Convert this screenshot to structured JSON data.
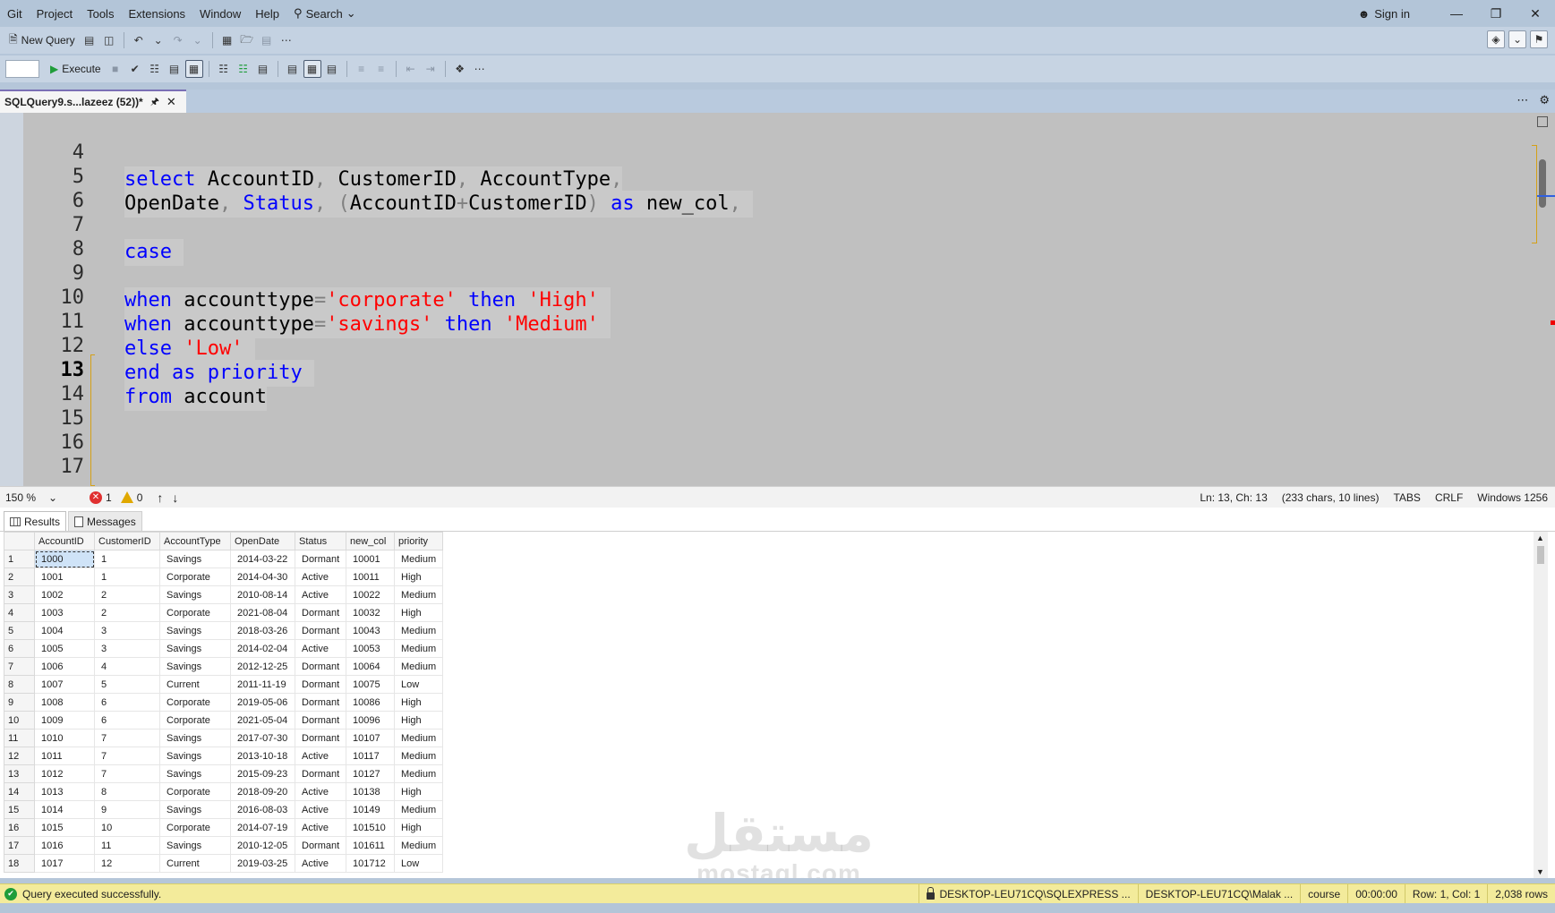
{
  "menu": {
    "items": [
      "Git",
      "Project",
      "Tools",
      "Extensions",
      "Window",
      "Help"
    ],
    "search_label": "Search",
    "sign_in": "Sign in"
  },
  "toolbar1": {
    "new_query": "New Query"
  },
  "toolbar2": {
    "execute": "Execute"
  },
  "doc_tab": {
    "title": "SQLQuery9.s...lazeez (52))*"
  },
  "editor": {
    "lines": [
      {
        "n": "4"
      },
      {
        "n": "5"
      },
      {
        "n": "6"
      },
      {
        "n": "7"
      },
      {
        "n": "8"
      },
      {
        "n": "9"
      },
      {
        "n": "10"
      },
      {
        "n": "11"
      },
      {
        "n": "12"
      },
      {
        "n": "13"
      },
      {
        "n": "14"
      },
      {
        "n": "15"
      },
      {
        "n": "16"
      },
      {
        "n": "17"
      }
    ],
    "code": {
      "l4": [
        "select",
        "AccountID",
        ",",
        "CustomerID",
        ",",
        "AccountType",
        ","
      ],
      "l5": [
        "OpenDate",
        ",",
        "Status",
        ",",
        "(",
        "AccountID",
        "+",
        "CustomerID",
        ")",
        "as",
        "new_col",
        ","
      ],
      "l7": [
        "case"
      ],
      "l9": [
        "when",
        "accounttype",
        "=",
        "'corporate'",
        "then",
        "'High'"
      ],
      "l10": [
        "when",
        "accounttype",
        "=",
        "'savings'",
        "then",
        "'Medium'"
      ],
      "l11": [
        "else",
        "'Low'"
      ],
      "l12": [
        "end",
        "as",
        "priority"
      ],
      "l13": [
        "from",
        "account"
      ]
    }
  },
  "editor_status": {
    "zoom": "150 %",
    "errors": "1",
    "warnings": "0",
    "position": "Ln: 13, Ch: 13",
    "chars": "(233 chars, 10 lines)",
    "tabs": "TABS",
    "eol": "CRLF",
    "encoding": "Windows 1256"
  },
  "results_tabs": {
    "results": "Results",
    "messages": "Messages"
  },
  "grid": {
    "columns": [
      "AccountID",
      "CustomerID",
      "AccountType",
      "OpenDate",
      "Status",
      "new_col",
      "priority"
    ],
    "rows": [
      [
        "1",
        "1000",
        "1",
        "Savings",
        "2014-03-22",
        "Dormant",
        "10001",
        "Medium"
      ],
      [
        "2",
        "1001",
        "1",
        "Corporate",
        "2014-04-30",
        "Active",
        "10011",
        "High"
      ],
      [
        "3",
        "1002",
        "2",
        "Savings",
        "2010-08-14",
        "Active",
        "10022",
        "Medium"
      ],
      [
        "4",
        "1003",
        "2",
        "Corporate",
        "2021-08-04",
        "Dormant",
        "10032",
        "High"
      ],
      [
        "5",
        "1004",
        "3",
        "Savings",
        "2018-03-26",
        "Dormant",
        "10043",
        "Medium"
      ],
      [
        "6",
        "1005",
        "3",
        "Savings",
        "2014-02-04",
        "Active",
        "10053",
        "Medium"
      ],
      [
        "7",
        "1006",
        "4",
        "Savings",
        "2012-12-25",
        "Dormant",
        "10064",
        "Medium"
      ],
      [
        "8",
        "1007",
        "5",
        "Current",
        "2011-11-19",
        "Dormant",
        "10075",
        "Low"
      ],
      [
        "9",
        "1008",
        "6",
        "Corporate",
        "2019-05-06",
        "Dormant",
        "10086",
        "High"
      ],
      [
        "10",
        "1009",
        "6",
        "Corporate",
        "2021-05-04",
        "Dormant",
        "10096",
        "High"
      ],
      [
        "11",
        "1010",
        "7",
        "Savings",
        "2017-07-30",
        "Dormant",
        "10107",
        "Medium"
      ],
      [
        "12",
        "1011",
        "7",
        "Savings",
        "2013-10-18",
        "Active",
        "10117",
        "Medium"
      ],
      [
        "13",
        "1012",
        "7",
        "Savings",
        "2015-09-23",
        "Dormant",
        "10127",
        "Medium"
      ],
      [
        "14",
        "1013",
        "8",
        "Corporate",
        "2018-09-20",
        "Active",
        "10138",
        "High"
      ],
      [
        "15",
        "1014",
        "9",
        "Savings",
        "2016-08-03",
        "Active",
        "10149",
        "Medium"
      ],
      [
        "16",
        "1015",
        "10",
        "Corporate",
        "2014-07-19",
        "Active",
        "101510",
        "High"
      ],
      [
        "17",
        "1016",
        "11",
        "Savings",
        "2010-12-05",
        "Dormant",
        "101611",
        "Medium"
      ],
      [
        "18",
        "1017",
        "12",
        "Current",
        "2019-03-25",
        "Active",
        "101712",
        "Low"
      ]
    ]
  },
  "watermark": {
    "arabic": "مستقل",
    "latin": "mostaql.com"
  },
  "status_bar": {
    "message": "Query executed successfully.",
    "server": "DESKTOP-LEU71CQ\\SQLEXPRESS ...",
    "user": "DESKTOP-LEU71CQ\\Malak ...",
    "database": "course",
    "elapsed": "00:00:00",
    "rowcol": "Row: 1, Col: 1",
    "rows": "2,038 rows"
  },
  "colors": {
    "keyword": "#0000ff",
    "string": "#ff0000",
    "operator": "#808080",
    "status_bar": "#f3eb9b"
  }
}
